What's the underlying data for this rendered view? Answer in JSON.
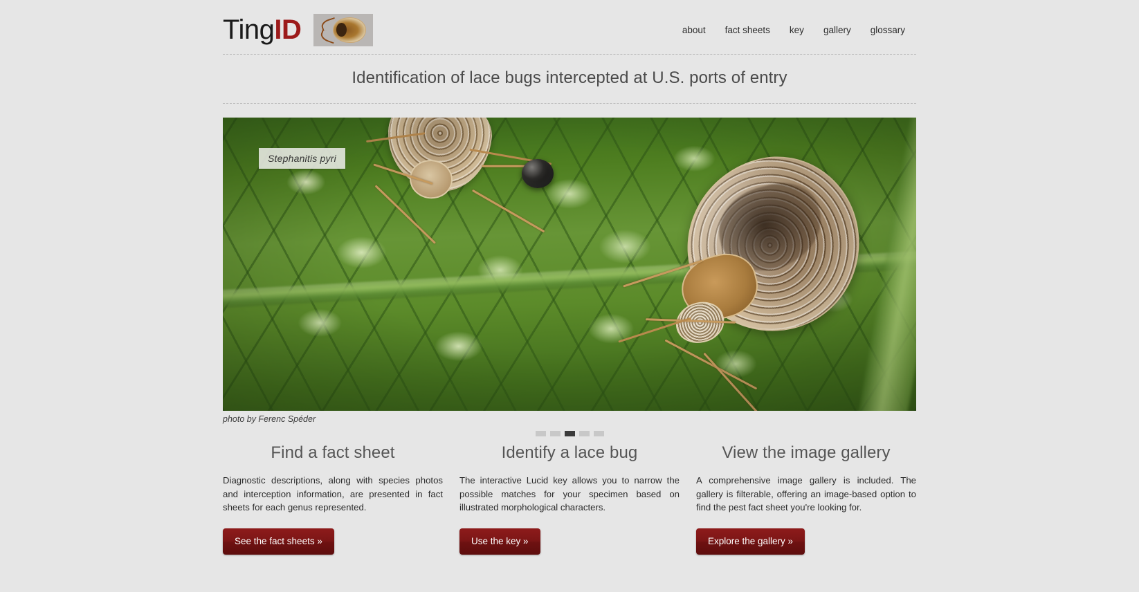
{
  "site": {
    "logo_primary": "Ting",
    "logo_accent": "ID",
    "logo_image_alt": "lace-bug-specimen",
    "tagline": "Identification of lace bugs intercepted at U.S. ports of entry",
    "accent_color": "#9c1a1a",
    "button_color": "#7d1616",
    "background_color": "#e6e6e6"
  },
  "nav": {
    "items": [
      {
        "label": "about"
      },
      {
        "label": "fact sheets"
      },
      {
        "label": "key"
      },
      {
        "label": "gallery"
      },
      {
        "label": "glossary"
      }
    ]
  },
  "hero": {
    "species_label": "Stephanitis pyri",
    "credit": "photo by Ferenc Spéder",
    "slides_total": 5,
    "active_slide": 3,
    "dots": [
      {
        "active": false
      },
      {
        "active": false
      },
      {
        "active": true
      },
      {
        "active": false
      },
      {
        "active": false
      }
    ]
  },
  "columns": [
    {
      "heading": "Find a fact sheet",
      "body": "Diagnostic descriptions, along with species photos and interception information, are presented in fact sheets for each genus represented.",
      "button": "See the fact sheets »"
    },
    {
      "heading": "Identify a lace bug",
      "body": "The interactive Lucid key allows you to narrow the possible matches for your specimen based on illustrated morphological characters.",
      "button": "Use the key »"
    },
    {
      "heading": "View the image gallery",
      "body": "A comprehensive image gallery is included. The gallery is filterable, offering an image-based option to find the pest fact sheet you're looking for.",
      "button": "Explore the gallery »"
    }
  ]
}
